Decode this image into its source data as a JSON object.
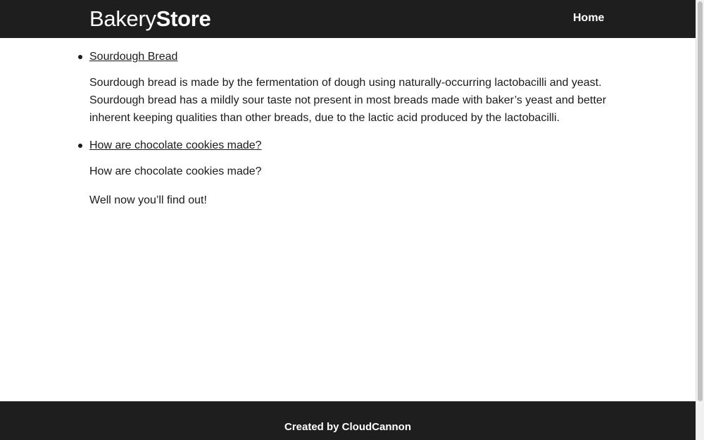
{
  "header": {
    "logo_light": "Bakery",
    "logo_bold": "Store",
    "nav_home": "Home"
  },
  "posts": [
    {
      "title": "Sourdough Bread",
      "excerpt_paragraphs": [
        "Sourdough bread is made by the fermentation of dough using naturally-occurring lactobacilli and yeast. Sourdough bread has a mildly sour taste not present in most breads made with baker’s yeast and better inherent keeping qualities than other breads, due to the lactic acid produced by the lactobacilli."
      ]
    },
    {
      "title": "How are chocolate cookies made?",
      "excerpt_paragraphs": [
        "How are chocolate cookies made?",
        "Well now you’ll find out!"
      ]
    }
  ],
  "footer": {
    "text": "Created by CloudCannon"
  },
  "colors": {
    "header_bg": "#1e1e1e",
    "footer_bg": "#1e1e1e",
    "text": "#1a1a1a",
    "header_text": "#ffffff"
  }
}
